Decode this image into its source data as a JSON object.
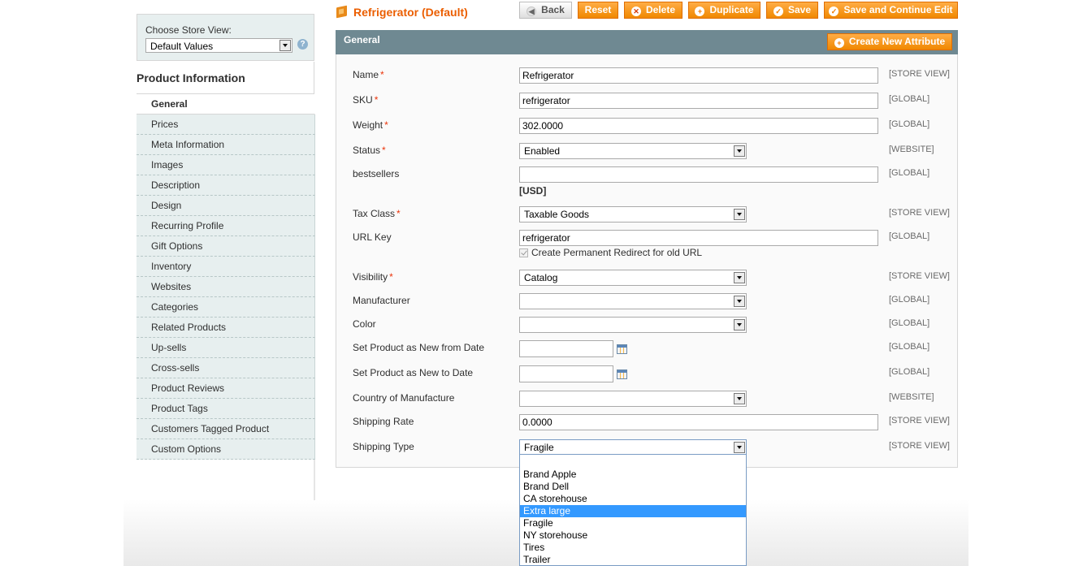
{
  "store_switcher": {
    "label": "Choose Store View:",
    "selected": "Default Values"
  },
  "sidebar": {
    "title": "Product Information",
    "tabs": [
      "General",
      "Prices",
      "Meta Information",
      "Images",
      "Description",
      "Design",
      "Recurring Profile",
      "Gift Options",
      "Inventory",
      "Websites",
      "Categories",
      "Related Products",
      "Up-sells",
      "Cross-sells",
      "Product Reviews",
      "Product Tags",
      "Customers Tagged Product",
      "Custom Options"
    ],
    "active_tab": "General"
  },
  "header": {
    "title": "Refrigerator (Default)",
    "buttons": {
      "back": "Back",
      "reset": "Reset",
      "delete": "Delete",
      "duplicate": "Duplicate",
      "save": "Save",
      "save_continue": "Save and Continue Edit"
    }
  },
  "panel": {
    "title": "General",
    "create_attribute": "Create New Attribute"
  },
  "form": {
    "name": {
      "label": "Name",
      "value": "Refrigerator",
      "scope": "[STORE VIEW]"
    },
    "sku": {
      "label": "SKU",
      "value": "refrigerator",
      "scope": "[GLOBAL]"
    },
    "weight": {
      "label": "Weight",
      "value": "302.0000",
      "scope": "[GLOBAL]"
    },
    "status": {
      "label": "Status",
      "value": "Enabled",
      "scope": "[WEBSITE]"
    },
    "bestsellers": {
      "label": "bestsellers",
      "value": "",
      "note": "[USD]",
      "scope": "[GLOBAL]"
    },
    "tax_class": {
      "label": "Tax Class",
      "value": "Taxable Goods",
      "scope": "[STORE VIEW]"
    },
    "url_key": {
      "label": "URL Key",
      "value": "refrigerator",
      "checkbox": "Create Permanent Redirect for old URL",
      "scope": "[GLOBAL]"
    },
    "visibility": {
      "label": "Visibility",
      "value": "Catalog",
      "scope": "[STORE VIEW]"
    },
    "manufacturer": {
      "label": "Manufacturer",
      "value": "",
      "scope": "[GLOBAL]"
    },
    "color": {
      "label": "Color",
      "value": "",
      "scope": "[GLOBAL]"
    },
    "new_from": {
      "label": "Set Product as New from Date",
      "value": "",
      "scope": "[GLOBAL]"
    },
    "new_to": {
      "label": "Set Product as New to Date",
      "value": "",
      "scope": "[GLOBAL]"
    },
    "country": {
      "label": "Country of Manufacture",
      "value": "",
      "scope": "[WEBSITE]"
    },
    "shipping_rate": {
      "label": "Shipping Rate",
      "value": "0.0000",
      "scope": "[STORE VIEW]"
    },
    "shipping_type": {
      "label": "Shipping Type",
      "value": "Fragile",
      "scope": "[STORE VIEW]"
    }
  },
  "shipping_type_options": [
    "",
    "Brand Apple",
    "Brand Dell",
    "CA storehouse",
    "Extra large",
    "Fragile",
    "NY storehouse",
    "Tires",
    "Trailer"
  ],
  "highlighted_option": "Extra large",
  "colors": {
    "accent": "#eb5e00",
    "button": "#f08800",
    "panel_header": "#6f8992",
    "sidebar_bg": "#e7efef",
    "highlight": "#3399ff"
  }
}
